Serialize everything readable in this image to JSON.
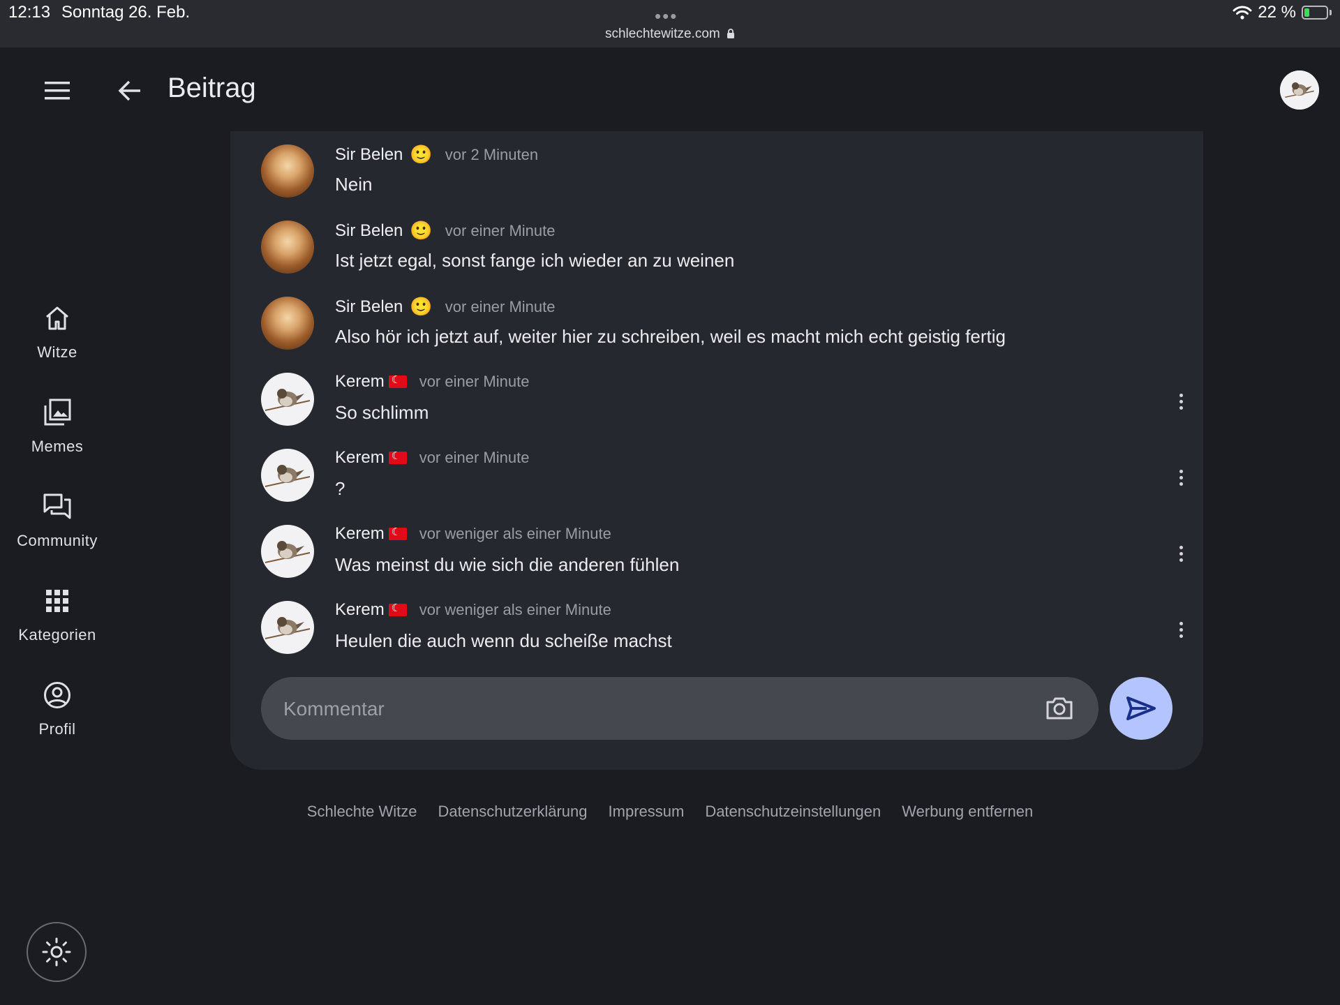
{
  "status_bar": {
    "time": "12:13",
    "date": "Sonntag 26. Feb.",
    "dots": "•••",
    "url": "schlechtewitze.com",
    "battery": "22 %",
    "battery_level": 0.22
  },
  "header": {
    "title": "Beitrag"
  },
  "nav": {
    "items": [
      {
        "label": "Witze",
        "icon": "home-icon"
      },
      {
        "label": "Memes",
        "icon": "images-icon"
      },
      {
        "label": "Community",
        "icon": "forum-icon"
      },
      {
        "label": "Kategorien",
        "icon": "grid-icon"
      },
      {
        "label": "Profil",
        "icon": "account-circle-icon"
      }
    ]
  },
  "comments": [
    {
      "author": "Sir Belen",
      "emoji": "🙂",
      "time": "vor 2 Minuten",
      "text": "Nein"
    },
    {
      "author": "Sir Belen",
      "emoji": "🙂",
      "time": "vor einer Minute",
      "text": "Ist jetzt egal, sonst fange ich wieder an zu weinen"
    },
    {
      "author": "Sir Belen",
      "emoji": "🙂",
      "time": "vor einer Minute",
      "text": "Also hör ich jetzt auf, weiter hier zu schreiben, weil es macht mich echt geistig fertig"
    },
    {
      "author": "Kerem",
      "time": "vor einer Minute",
      "text": "So schlimm"
    },
    {
      "author": "Kerem",
      "time": "vor einer Minute",
      "text": "?"
    },
    {
      "author": "Kerem",
      "time": "vor weniger als einer Minute",
      "text": "Was meinst du wie sich die anderen fühlen"
    },
    {
      "author": "Kerem",
      "time": "vor weniger als einer Minute",
      "text": "Heulen die auch wenn du scheiße machst"
    }
  ],
  "comment_input": {
    "placeholder": "Kommentar"
  },
  "footer": {
    "links": [
      "Schlechte Witze",
      "Datenschutzerklärung",
      "Impressum",
      "Datenschutzeinstellungen",
      "Werbung entfernen"
    ]
  },
  "colors": {
    "background": "#1b1c22",
    "card": "#262830",
    "send_button": "#b3c4ff",
    "flag_red": "#e30a17"
  }
}
